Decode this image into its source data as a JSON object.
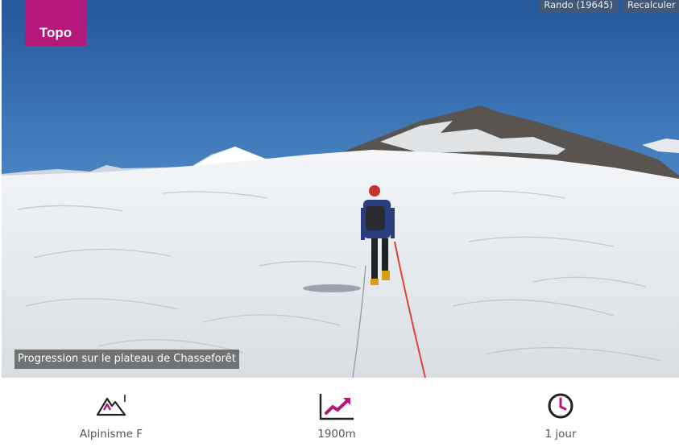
{
  "hero": {
    "tag": "Topo",
    "caption": "Progression sur le plateau de Chasseforêt",
    "links": [
      "Rando (19645)",
      "Recalculer c"
    ]
  },
  "stats": [
    {
      "icon": "mountain-icon",
      "label": "Alpinisme F"
    },
    {
      "icon": "elevation-chart-icon",
      "label": "1900m"
    },
    {
      "icon": "clock-icon",
      "label": "1 jour"
    }
  ],
  "colors": {
    "accent": "#b5177a",
    "sky": "#2c63a6"
  }
}
